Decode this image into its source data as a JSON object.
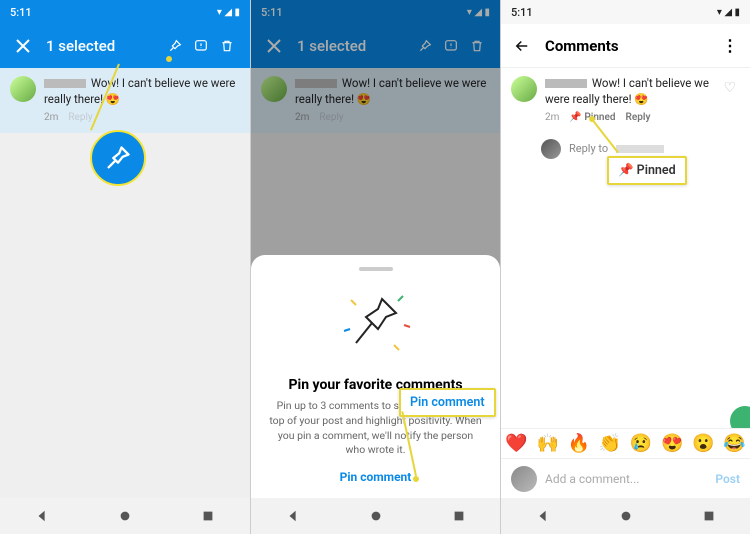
{
  "status": {
    "time": "5:11",
    "icons": "▾ ◢ ▮"
  },
  "panel1": {
    "header": {
      "title": "1 selected"
    },
    "comment": {
      "text": "Wow! I can't believe we were really there! 😍",
      "time": "2m",
      "reply": "Reply"
    }
  },
  "panel2": {
    "header": {
      "title": "1 selected"
    },
    "comment": {
      "text": "Wow! I can't believe we were really there! 😍",
      "time": "2m",
      "reply": "Reply"
    },
    "sheet": {
      "title": "Pin your favorite comments",
      "desc": "Pin up to 3 comments to show them at the top of your post and highlight positivity. When you pin a comment, we'll notify the person who wrote it.",
      "action": "Pin comment"
    },
    "callout": "Pin comment"
  },
  "panel3": {
    "header": {
      "title": "Comments"
    },
    "comment": {
      "text": "Wow! I can't believe we were really there! 😍",
      "time": "2m",
      "pinned": "📌 Pinned",
      "reply": "Reply"
    },
    "replyRow": {
      "prefix": "Reply to"
    },
    "callout": "📌 Pinned",
    "emoji": [
      "❤️",
      "🙌",
      "🔥",
      "👏",
      "😢",
      "😍",
      "😮",
      "😂"
    ],
    "input": {
      "placeholder": "Add a comment...",
      "post": "Post"
    }
  }
}
